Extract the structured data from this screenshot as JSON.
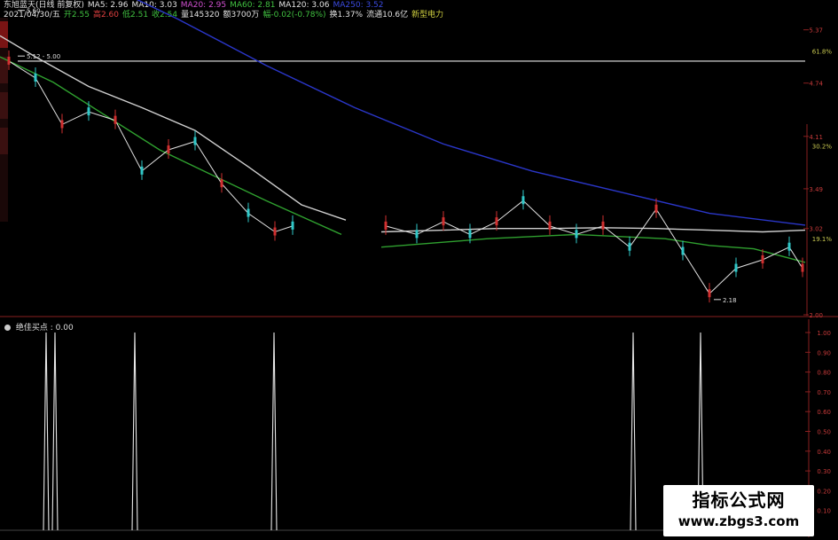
{
  "header": {
    "line1": [
      {
        "text": "东旭蓝天(日线 前复权)",
        "color": "#e0e0e0"
      },
      {
        "text": "MA5: 2.96",
        "color": "#e0e0e0"
      },
      {
        "text": "MA10: 3.03",
        "color": "#e0e0e0"
      },
      {
        "text": "MA20: 2.95",
        "color": "#d050d0"
      },
      {
        "text": "MA60: 2.81",
        "color": "#40c040"
      },
      {
        "text": "MA120: 3.06",
        "color": "#e0e0e0"
      },
      {
        "text": "MA250: 3.52",
        "color": "#3a4adf"
      }
    ],
    "line2": [
      {
        "text": "2021/04/30/五",
        "color": "#e0e0e0"
      },
      {
        "text": "开2.55",
        "color": "#40c040"
      },
      {
        "text": "高2.60",
        "color": "#e04040"
      },
      {
        "text": "低2.51",
        "color": "#40c040"
      },
      {
        "text": "收2.54",
        "color": "#40c040"
      },
      {
        "text": "量145320",
        "color": "#e0e0e0"
      },
      {
        "text": "额3700万",
        "color": "#e0e0e0"
      },
      {
        "text": "幅-0.02(-0.78%)",
        "color": "#40c040"
      },
      {
        "text": "换1.37%",
        "color": "#e0e0e0"
      },
      {
        "text": "流通10.6亿",
        "color": "#e0e0e0"
      },
      {
        "text": "新型电力",
        "color": "#d0d040"
      }
    ]
  },
  "indicator": {
    "title": "绝佳买点 : 0.00",
    "y_ticks": [
      "1.00",
      "0.90",
      "0.80",
      "0.70",
      "0.60",
      "0.50",
      "0.40",
      "0.30",
      "0.20",
      "0.10"
    ]
  },
  "watermark": {
    "title": "指标公式网",
    "url": "www.zbgs3.com"
  },
  "chart_data": [
    {
      "type": "line",
      "title": "东旭蓝天(日线 前复权)",
      "ylim": [
        2.0,
        5.45
      ],
      "y_ticks": [
        "5.37",
        "4.74",
        "4.11",
        "3.49",
        "3.02",
        "2.00"
      ],
      "pct_ticks": [
        "61.8%",
        "30.2%",
        "19.1%"
      ],
      "horizontal_line": 5.0,
      "annotations": [
        {
          "text": "5.60",
          "x": 20,
          "y": 5.6
        },
        {
          "text": "5.12 - 5.00",
          "x": 20,
          "y": 5.06
        },
        {
          "text": "2.18",
          "x": 805,
          "y": 2.18
        }
      ],
      "series": [
        {
          "name": "MA250",
          "color": "#2a36c8",
          "x": [
            0,
            100,
            200,
            300,
            400,
            500,
            600,
            700,
            800,
            908
          ],
          "y": [
            6.55,
            6.0,
            5.5,
            4.95,
            4.45,
            4.02,
            3.7,
            3.45,
            3.2,
            3.06
          ]
        },
        {
          "name": "MA120",
          "color": "#cfcfcf",
          "x": [
            0,
            40,
            100,
            160,
            220,
            280,
            340,
            390
          ],
          "y": [
            5.3,
            5.05,
            4.7,
            4.45,
            4.18,
            3.75,
            3.3,
            3.12
          ]
        },
        {
          "name": "MA60",
          "color": "#2fa02f",
          "x": [
            0,
            60,
            120,
            180,
            240,
            300,
            385
          ],
          "y": [
            5.05,
            4.75,
            4.35,
            3.95,
            3.65,
            3.35,
            2.95
          ]
        },
        {
          "name": "MA120",
          "color": "#cfcfcf",
          "x": [
            430,
            500,
            560,
            620,
            680,
            740,
            800,
            860,
            908
          ],
          "y": [
            2.98,
            3.0,
            3.02,
            3.02,
            3.03,
            3.02,
            3.0,
            2.98,
            3.0
          ]
        },
        {
          "name": "MA60",
          "color": "#2fa02f",
          "x": [
            430,
            550,
            650,
            750,
            800,
            850,
            908
          ],
          "y": [
            2.8,
            2.9,
            2.95,
            2.9,
            2.82,
            2.78,
            2.62
          ]
        }
      ],
      "candles": {
        "x": [
          10,
          40,
          70,
          100,
          130,
          160,
          190,
          220,
          250,
          280,
          310,
          330,
          435,
          470,
          500,
          530,
          560,
          590,
          620,
          650,
          680,
          710,
          740,
          770,
          800,
          830,
          860,
          890,
          905
        ],
        "y": [
          5.0,
          4.8,
          4.25,
          4.4,
          4.3,
          3.7,
          3.95,
          4.05,
          3.55,
          3.2,
          2.98,
          3.05,
          3.05,
          2.95,
          3.1,
          2.95,
          3.1,
          3.35,
          3.05,
          2.95,
          3.05,
          2.8,
          3.25,
          2.75,
          2.25,
          2.55,
          2.65,
          2.8,
          2.55
        ]
      }
    },
    {
      "type": "bar",
      "title": "绝佳买点",
      "ylim": [
        0,
        1.0
      ],
      "x": [
        52,
        62,
        152,
        309,
        714,
        790
      ],
      "values": [
        1.0,
        1.0,
        1.0,
        1.0,
        1.0,
        1.0
      ]
    }
  ]
}
